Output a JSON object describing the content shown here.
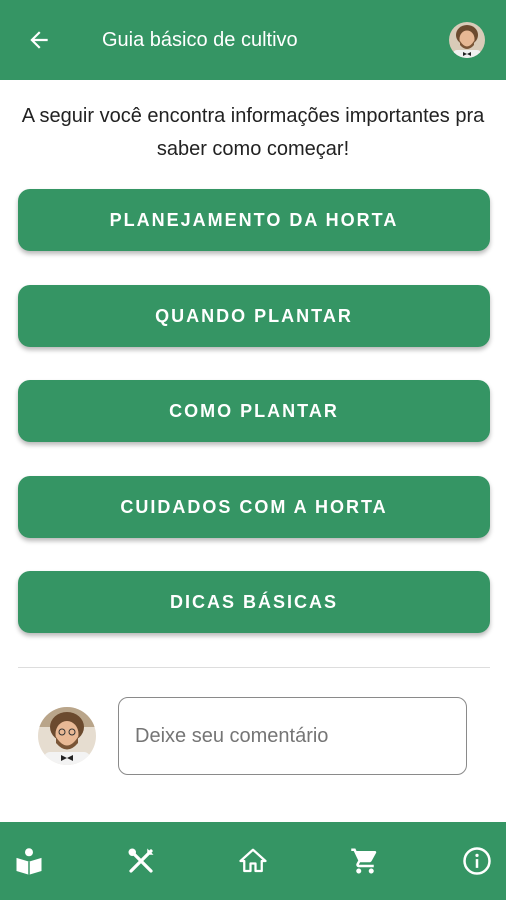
{
  "header": {
    "title": "Guia básico de cultivo",
    "back_icon": "arrow-left-icon",
    "bar_color": "#359564"
  },
  "intro": {
    "text": "A seguir você encontra informações importantes pra saber como começar!"
  },
  "guide_buttons": [
    {
      "label": "PLANEJAMENTO DA HORTA"
    },
    {
      "label": "QUANDO PLANTAR"
    },
    {
      "label": "COMO PLANTAR"
    },
    {
      "label": "CUIDADOS COM A HORTA"
    },
    {
      "label": "DICAS BÁSICAS"
    }
  ],
  "comment": {
    "placeholder": "Deixe seu comentário"
  },
  "bottom_nav": {
    "items": [
      {
        "icon": "book-reader-icon",
        "active": true
      },
      {
        "icon": "tools-icon",
        "active": false
      },
      {
        "icon": "home-icon",
        "active": false
      },
      {
        "icon": "cart-icon",
        "active": false
      },
      {
        "icon": "info-icon",
        "active": false
      }
    ]
  }
}
